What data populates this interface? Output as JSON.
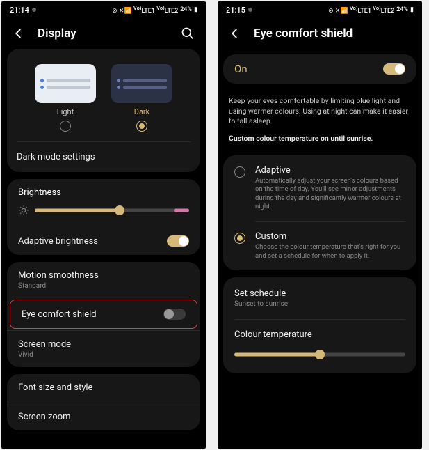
{
  "screen1": {
    "status": {
      "time": "21:14",
      "battery": "24%",
      "indicators": "⋮ ⊘ 📶 LTE1 LTE2 Vo"
    },
    "header": {
      "title": "Display"
    },
    "theme": {
      "light_label": "Light",
      "dark_label": "Dark",
      "selected": "dark"
    },
    "dark_mode_settings": "Dark mode settings",
    "brightness": {
      "title": "Brightness",
      "value": 55,
      "pink_end": 10
    },
    "adaptive_brightness": {
      "label": "Adaptive brightness",
      "on": true
    },
    "motion": {
      "label": "Motion smoothness",
      "sub": "Standard"
    },
    "eye_comfort": {
      "label": "Eye comfort shield",
      "on": false
    },
    "screen_mode": {
      "label": "Screen mode",
      "sub": "Vivid"
    },
    "font": "Font size and style",
    "zoom": "Screen zoom"
  },
  "screen2": {
    "status": {
      "time": "21:15",
      "battery": "24%",
      "indicators": "⋮ ⊘ 📶 LTE1 LTE2 Vo"
    },
    "header": {
      "title": "Eye comfort shield"
    },
    "on": {
      "label": "On",
      "value": true
    },
    "desc": "Keep your eyes comfortable by limiting blue light and using warmer colours. Using at night can make it easier to fall asleep.",
    "desc_bold": "Custom colour temperature on until sunrise.",
    "options": {
      "adaptive": {
        "title": "Adaptive",
        "sub": "Automatically adjust your screen's colours based on the time of day. You'll see minor adjustments during the day and significantly warmer colours at night."
      },
      "custom": {
        "title": "Custom",
        "sub": "Choose the colour temperature that's right for you and set a schedule for when to apply it."
      },
      "selected": "custom"
    },
    "schedule": {
      "title": "Set schedule",
      "sub": "Sunset to sunrise"
    },
    "temperature": {
      "title": "Colour temperature",
      "value": 50
    }
  }
}
